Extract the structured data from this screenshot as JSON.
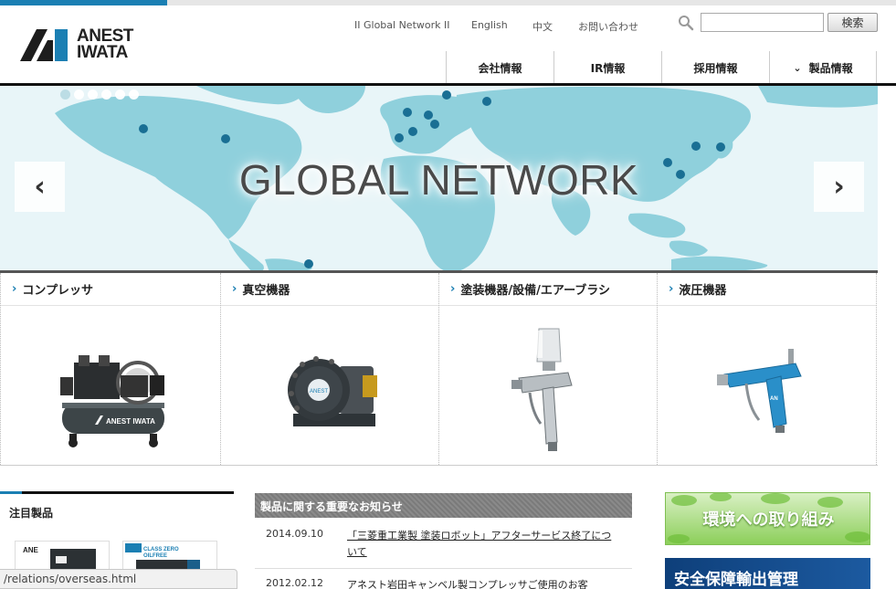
{
  "header": {
    "logo_text_line1": "ANEST",
    "logo_text_line2": "IWATA",
    "utility_links": [
      "II Global Network II",
      "English",
      "中文",
      "お問い合わせ"
    ],
    "search_placeholder": "",
    "search_button": "検索"
  },
  "global_nav": [
    {
      "label": "会社情報",
      "has_chevron": false
    },
    {
      "label": "IR情報",
      "has_chevron": false
    },
    {
      "label": "採用情報",
      "has_chevron": false
    },
    {
      "label": "製品情報",
      "has_chevron": true
    }
  ],
  "hero": {
    "title": "GLOBAL NETWORK",
    "slide_count": 6,
    "active_slide": 1
  },
  "categories": [
    {
      "label": "コンプレッサ",
      "icon": "compressor-image"
    },
    {
      "label": "真空機器",
      "icon": "vacuum-pump-image"
    },
    {
      "label": "塗装機器/設備/エアーブラシ",
      "icon": "spray-gun-image"
    },
    {
      "label": "液圧機器",
      "icon": "fluid-gun-image"
    }
  ],
  "featured": {
    "title": "注目製品"
  },
  "notices": {
    "title": "製品に関する重要なお知らせ",
    "items": [
      {
        "date": "2014.09.10",
        "text": "「三菱重工業製 塗装ロボット」アフターサービス終了について"
      },
      {
        "date": "2012.02.12",
        "text": "アネスト岩田キャンベル製コンプレッサご使用のお客"
      }
    ]
  },
  "banners": {
    "environment": "環境への取り組み",
    "security_export": "安全保障輸出管理"
  },
  "status_bar": {
    "url": "/relations/overseas.html"
  },
  "colors": {
    "accent": "#1b7fb3",
    "map_land": "#8fd0dc",
    "map_sea": "#e8f5f8",
    "map_dot": "#1a6f94"
  }
}
